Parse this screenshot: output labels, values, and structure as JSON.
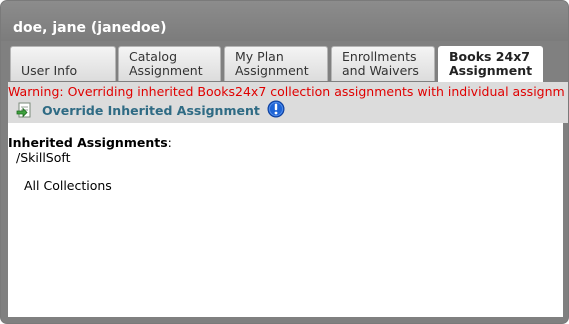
{
  "window": {
    "title": "doe, jane (janedoe)"
  },
  "tabs": [
    {
      "label": "User Info",
      "active": false
    },
    {
      "label": "Catalog\nAssignment",
      "active": false
    },
    {
      "label": "My Plan\nAssignment",
      "active": false
    },
    {
      "label": "Enrollments\nand Waivers",
      "active": false
    },
    {
      "label": "Books 24x7\nAssignment",
      "active": true
    }
  ],
  "toolbar": {
    "warning": "Warning: Overriding inherited Books24x7 collection assignments with individual assignm",
    "override_label": "Override Inherited Assignment",
    "override_icon": "override-edit-icon",
    "info_icon": "info-icon"
  },
  "content": {
    "heading": "Inherited Assignments",
    "heading_suffix": ":",
    "path": "/SkillSoft",
    "collection": "All Collections"
  },
  "colors": {
    "frame": "#808080",
    "warning": "#e00000",
    "link": "#2f6b84",
    "toolbar_bg": "#dcdcdc",
    "info_blue": "#1e64d6"
  }
}
